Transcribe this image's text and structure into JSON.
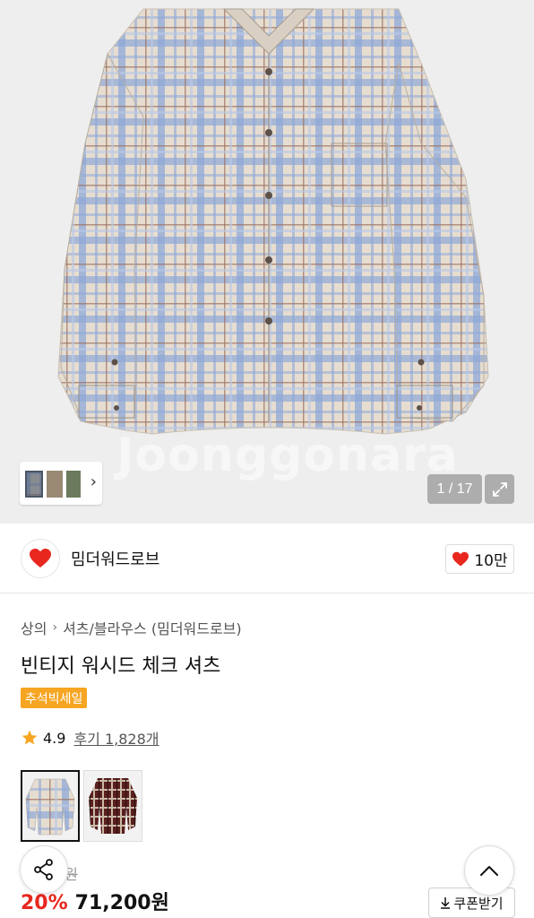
{
  "hero": {
    "watermark": "Joonggonara",
    "image_counter": "1 / 17",
    "icons": {
      "expand": "expand-icon",
      "thumb_chevron": "chevron-right-icon"
    }
  },
  "store": {
    "name": "밈더워드로브",
    "like_count": "10만",
    "icons": {
      "like": "heart-icon"
    },
    "colors": {
      "heart": "#e8271e"
    }
  },
  "product": {
    "breadcrumb": [
      "상의",
      "셔츠/블라우스 (밈더워드로브)"
    ],
    "title": "빈티지 워시드 체크 셔츠",
    "badge": "추석빅세일",
    "rating": "4.9",
    "reviews": "후기 1,828개",
    "colors": {
      "badge": "#f6a623",
      "star": "#f6a623"
    }
  },
  "price": {
    "old_price_visible": "0원",
    "discount": "20%",
    "current": "71,200원",
    "coupon_label": "쿠폰받기",
    "colors": {
      "discount": "#e8271e"
    }
  },
  "floating": {
    "share_icon": "share-icon",
    "top_icon": "chevron-up-icon"
  }
}
